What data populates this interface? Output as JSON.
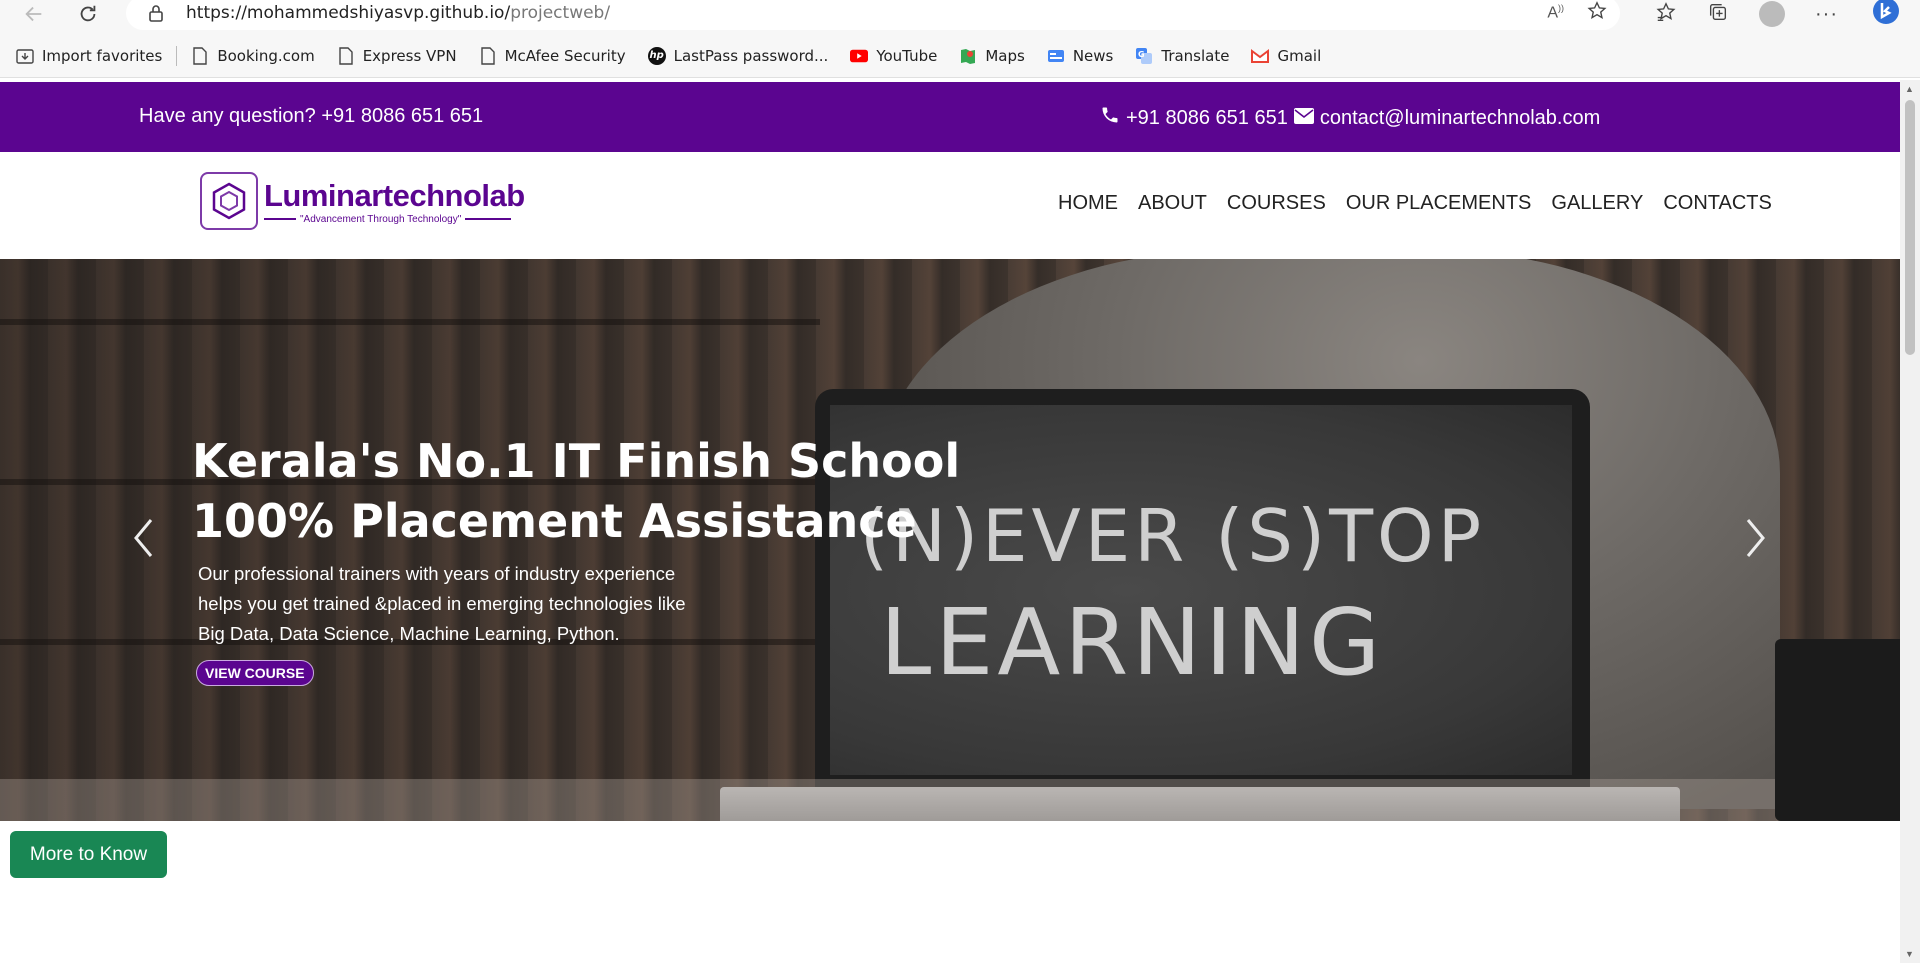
{
  "browser": {
    "url_host": "https://mohammedshiyasvp.github.io/",
    "url_path": "projectweb/",
    "bookmarks": [
      {
        "label": "Import favorites",
        "icon": "import-icon"
      },
      {
        "label": "Booking.com",
        "icon": "page-icon"
      },
      {
        "label": "Express VPN",
        "icon": "page-icon"
      },
      {
        "label": "McAfee Security",
        "icon": "page-icon"
      },
      {
        "label": "LastPass password...",
        "icon": "hp-icon"
      },
      {
        "label": "YouTube",
        "icon": "youtube-icon"
      },
      {
        "label": "Maps",
        "icon": "maps-icon"
      },
      {
        "label": "News",
        "icon": "news-icon"
      },
      {
        "label": "Translate",
        "icon": "translate-icon"
      },
      {
        "label": "Gmail",
        "icon": "gmail-icon"
      }
    ]
  },
  "topbar": {
    "question": "Have any question? +91 8086 651 651",
    "phone": "+91 8086 651 651",
    "email": "contact@luminartechnolab.com"
  },
  "header": {
    "logo_name": "Luminartechnolab",
    "logo_tagline": "\"Advancement Through Technology\"",
    "menu": [
      "HOME",
      "ABOUT",
      "COURSES",
      "OUR PLACEMENTS",
      "GALLERY",
      "CONTACTS"
    ]
  },
  "hero": {
    "title_line1": "Kerala's No.1 IT Finish School",
    "title_line2": "100% Placement Assistance",
    "desc_line1": "Our professional trainers with years of industry experience",
    "desc_line2": "helps you get trained &placed in emerging technologies like",
    "desc_line3": "Big Data, Data Science, Machine Learning, Python.",
    "button": "VIEW COURSE",
    "chalk_line1": "(N)EVER (S)TOP",
    "chalk_line2": "LEARNING"
  },
  "more_button": "More to Know",
  "colors": {
    "brand_purple": "#5b0590",
    "button_green": "#198754"
  }
}
